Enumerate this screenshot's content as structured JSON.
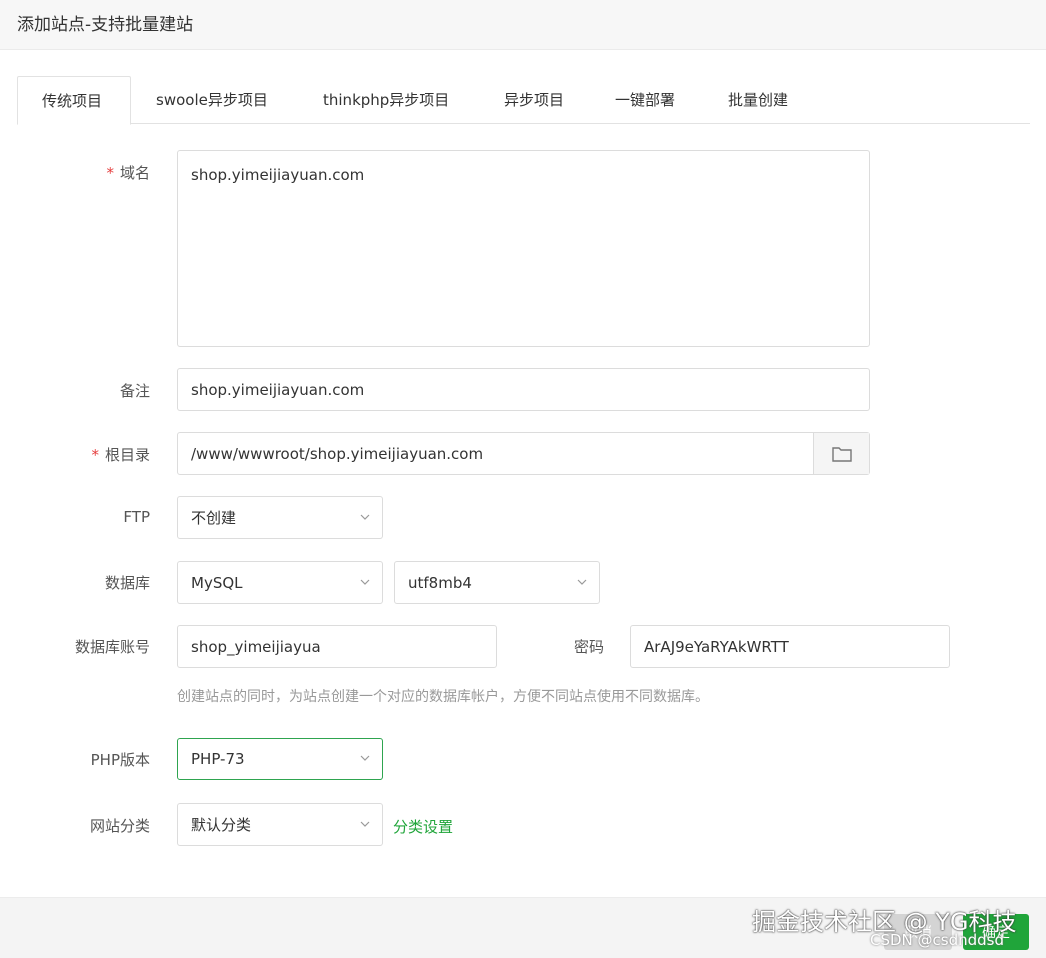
{
  "dialog": {
    "title": "添加站点-支持批量建站"
  },
  "tabs": [
    {
      "label": "传统项目"
    },
    {
      "label": "swoole异步项目"
    },
    {
      "label": "thinkphp异步项目"
    },
    {
      "label": "异步项目"
    },
    {
      "label": "一键部署"
    },
    {
      "label": "批量创建"
    }
  ],
  "form": {
    "required_mark": "*",
    "domain": {
      "label": "域名",
      "value": "shop.yimeijiayuan.com"
    },
    "remark": {
      "label": "备注",
      "value": "shop.yimeijiayuan.com"
    },
    "root": {
      "label": "根目录",
      "value": "/www/wwwroot/shop.yimeijiayuan.com"
    },
    "ftp": {
      "label": "FTP",
      "value": "不创建"
    },
    "database": {
      "label": "数据库",
      "type": "MySQL",
      "charset": "utf8mb4"
    },
    "db_account": {
      "label": "数据库账号",
      "value": "shop_yimeijiayua"
    },
    "password": {
      "label": "密码",
      "value": "ArAJ9eYaRYAkWRTT"
    },
    "db_hint": "创建站点的同时，为站点创建一个对应的数据库帐户，方便不同站点使用不同数据库。",
    "php": {
      "label": "PHP版本",
      "value": "PHP-73"
    },
    "category": {
      "label": "网站分类",
      "value": "默认分类",
      "link": "分类设置"
    }
  },
  "footer": {
    "cancel": "取消",
    "ok": "确定"
  },
  "watermark": {
    "main": "掘金技术社区 @ YG科技",
    "sub": "CSDN @csdnddsd"
  },
  "colors": {
    "accent": "#20a53a",
    "required": "#e53e3e"
  }
}
